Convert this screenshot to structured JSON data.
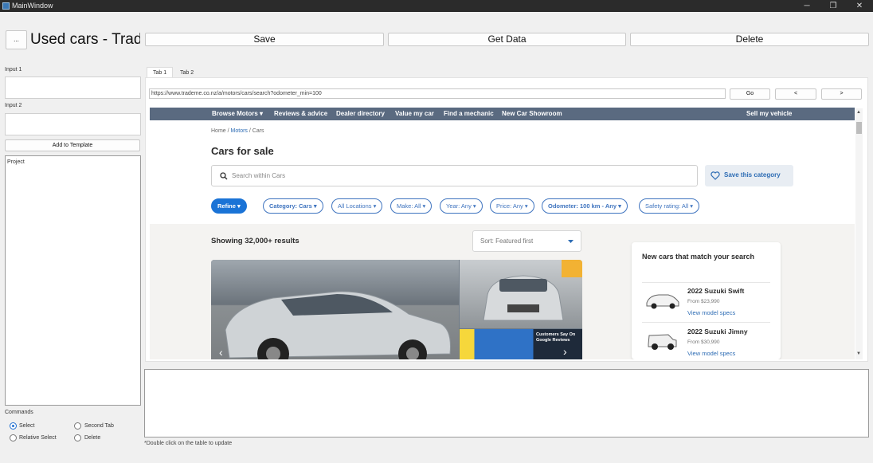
{
  "window": {
    "title": "MainWindow",
    "minimize": "─",
    "maximize": "❐",
    "close": "✕"
  },
  "toolbar": {
    "menu_button": "...",
    "heading": "Used cars - Trad",
    "save_label": "Save",
    "get_data_label": "Get Data",
    "delete_label": "Delete"
  },
  "left_panel": {
    "input1_label": "Input 1",
    "input1_value": "",
    "input2_label": "Input 2",
    "input2_value": "",
    "add_template_label": "Add to Template",
    "project_text": "Project",
    "commands_label": "Commands",
    "radios": {
      "select": "Select",
      "second_tab": "Second Tab",
      "relative_select": "Relative Select",
      "delete": "Delete"
    },
    "selected_radio": "Select"
  },
  "tabs": [
    "Tab 1",
    "Tab 2"
  ],
  "browser": {
    "url": "https://www.trademe.co.nz/a/motors/cars/search?odometer_min=100",
    "go_label": "Go",
    "back_label": "<",
    "forward_label": ">"
  },
  "site": {
    "nav": [
      "Browse Motors ▾",
      "Reviews & advice",
      "Dealer directory",
      "Value my car",
      "Find a mechanic",
      "New Car Showroom"
    ],
    "sell_label": "Sell my vehicle",
    "breadcrumb": {
      "home": "Home",
      "sep": " / ",
      "motors": "Motors",
      "cars": "Cars"
    },
    "page_title": "Cars for sale",
    "search_placeholder": "Search within Cars",
    "save_category_label": "Save this category",
    "filters": [
      "Refine ▾",
      "Category: Cars ▾",
      "All Locations ▾",
      "Make: All ▾",
      "Year: Any ▾",
      "Price: Any ▾",
      "Odometer: 100 km - Any ▾",
      "Safety rating: All ▾"
    ],
    "results_text": "Showing 32,000+ results",
    "sort_label": "Sort: Featured first",
    "gallery_banner": "Customers Say On Google Reviews",
    "new_cars_heading": "New cars that match your search",
    "new_cars": [
      {
        "name": "2022 Suzuki Swift",
        "price": "From $23,990",
        "link": "View model specs"
      },
      {
        "name": "2022 Suzuki Jimny",
        "price": "From $30,990",
        "link": "View model specs"
      }
    ]
  },
  "footer_hint": "*Double click on the table to update",
  "colors": {
    "accent": "#1a73d6",
    "nav_bg": "#5a6a80",
    "titlebar": "#2b2b2b"
  }
}
